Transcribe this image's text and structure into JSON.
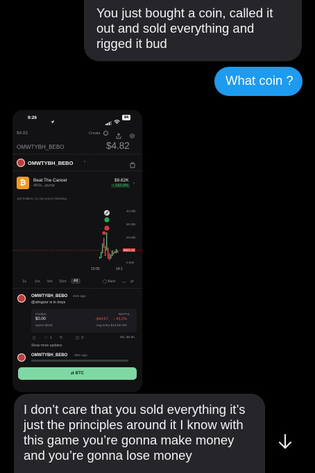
{
  "messages": {
    "top": "You just bought a coin, called it out and sold everything and rigged it bud",
    "coin": "What coin ?",
    "bottom": "I don’t care that you sold everything it’s just the principles around it I know with this game you’re gonna make money and you’re gonna lose money"
  },
  "icons": {
    "scroll_down": "arrow-down-icon"
  },
  "phone": {
    "status": {
      "time": "9:26",
      "battery": "84"
    },
    "header": {
      "price_small": "$4.82",
      "create": "Create"
    },
    "account": {
      "name": "OMWTYBH_BEBO",
      "price": "$4.82",
      "sub": "OMWTYBH_BEBO"
    },
    "coin": {
      "name": "Beat The Cancer",
      "sub": "46Sc...pump",
      "value": "$9.62K",
      "change": "↑ 152.0%"
    },
    "holders_text": "153 holders, no one you're following",
    "chart": {
      "y_labels": [
        "40.00k",
        "30.00k",
        "20.00k",
        "0.000"
      ],
      "current_label": "9621.41",
      "x_labels": [
        "13:00",
        "14:1"
      ]
    },
    "timeframes": [
      "1s",
      "1m",
      "5m",
      "15m",
      "All"
    ],
    "alert": "Alert",
    "activity": {
      "name": "OMWTYBH_BEBO",
      "time": "44m ago",
      "text": "@slingoor is in boys",
      "position_label": "Position",
      "position_value": "$0.00",
      "spent": "Spent $103",
      "pnl_label": "Net PnL",
      "pnl_value": "-$44.67",
      "pnl_pct": "↓ 43.2%",
      "avg_entry": "Avg entry $18.6K MC",
      "mc": "MC $9.6K",
      "likes": "1",
      "reposts": "3",
      "show_more": "Show more updates"
    },
    "activity2": {
      "name": "OMWTYBH_BEBO",
      "time": "49m ago"
    },
    "buy_button": "⇄ BTC"
  },
  "colors": {
    "sent_bubble": "#1d9bf0",
    "received_bubble": "#26262a",
    "up": "#43c36b",
    "down": "#ec4b4b"
  }
}
